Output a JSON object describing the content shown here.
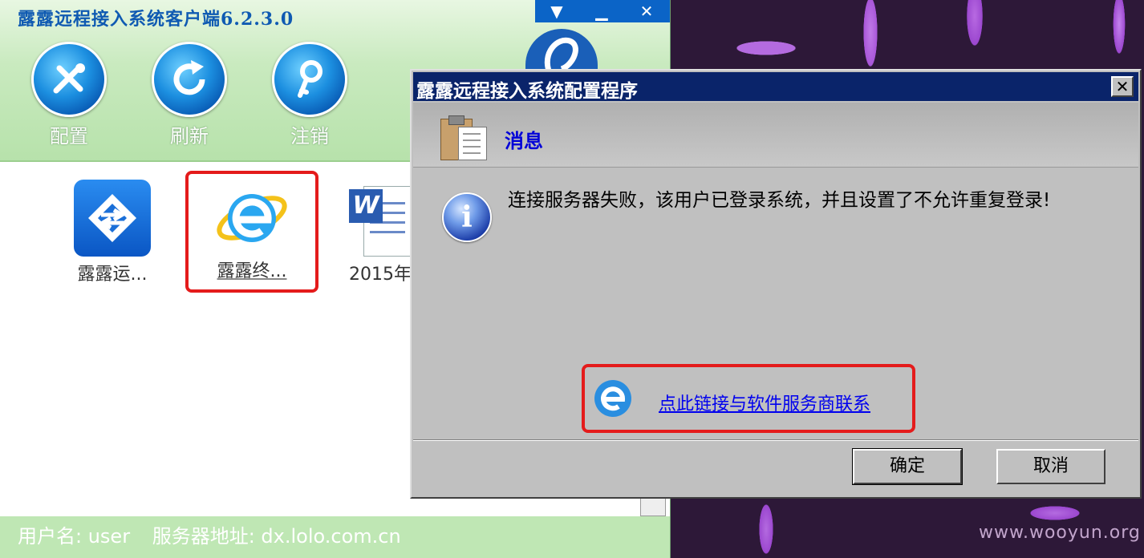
{
  "client": {
    "title": "露露远程接入系统客户端6.2.3.0",
    "window_controls": {
      "dropdown": "▼",
      "minimize": "▁",
      "close": "✕"
    },
    "toolbar": [
      {
        "label": "配置",
        "icon": "tools-icon"
      },
      {
        "label": "刷新",
        "icon": "refresh-icon"
      },
      {
        "label": "注销",
        "icon": "key-icon"
      }
    ],
    "desktop_items": [
      {
        "label": "露露运...",
        "icon": "arrows-app-icon"
      },
      {
        "label": "露露终...",
        "icon": "ie-browser-icon"
      },
      {
        "label": "2015年",
        "icon": "word-doc-icon"
      }
    ],
    "status": {
      "user": "用户名: user",
      "server": "服务器地址: dx.lolo.com.cn"
    }
  },
  "dialog": {
    "title": "露露远程接入系统配置程序",
    "close": "✕",
    "header_title": "消息",
    "info_glyph": "i",
    "message": "连接服务器失败，该用户已登录系统，并且设置了不允许重复登录!",
    "link": "点此链接与软件服务商联系",
    "ok_label": "确定",
    "cancel_label": "取消"
  },
  "watermark": "www.wooyun.org",
  "colors": {
    "client_title": "#0f5ab2",
    "dialog_titlebar": "#0a246a",
    "highlight": "#e41b1b",
    "link": "#0000ee"
  }
}
